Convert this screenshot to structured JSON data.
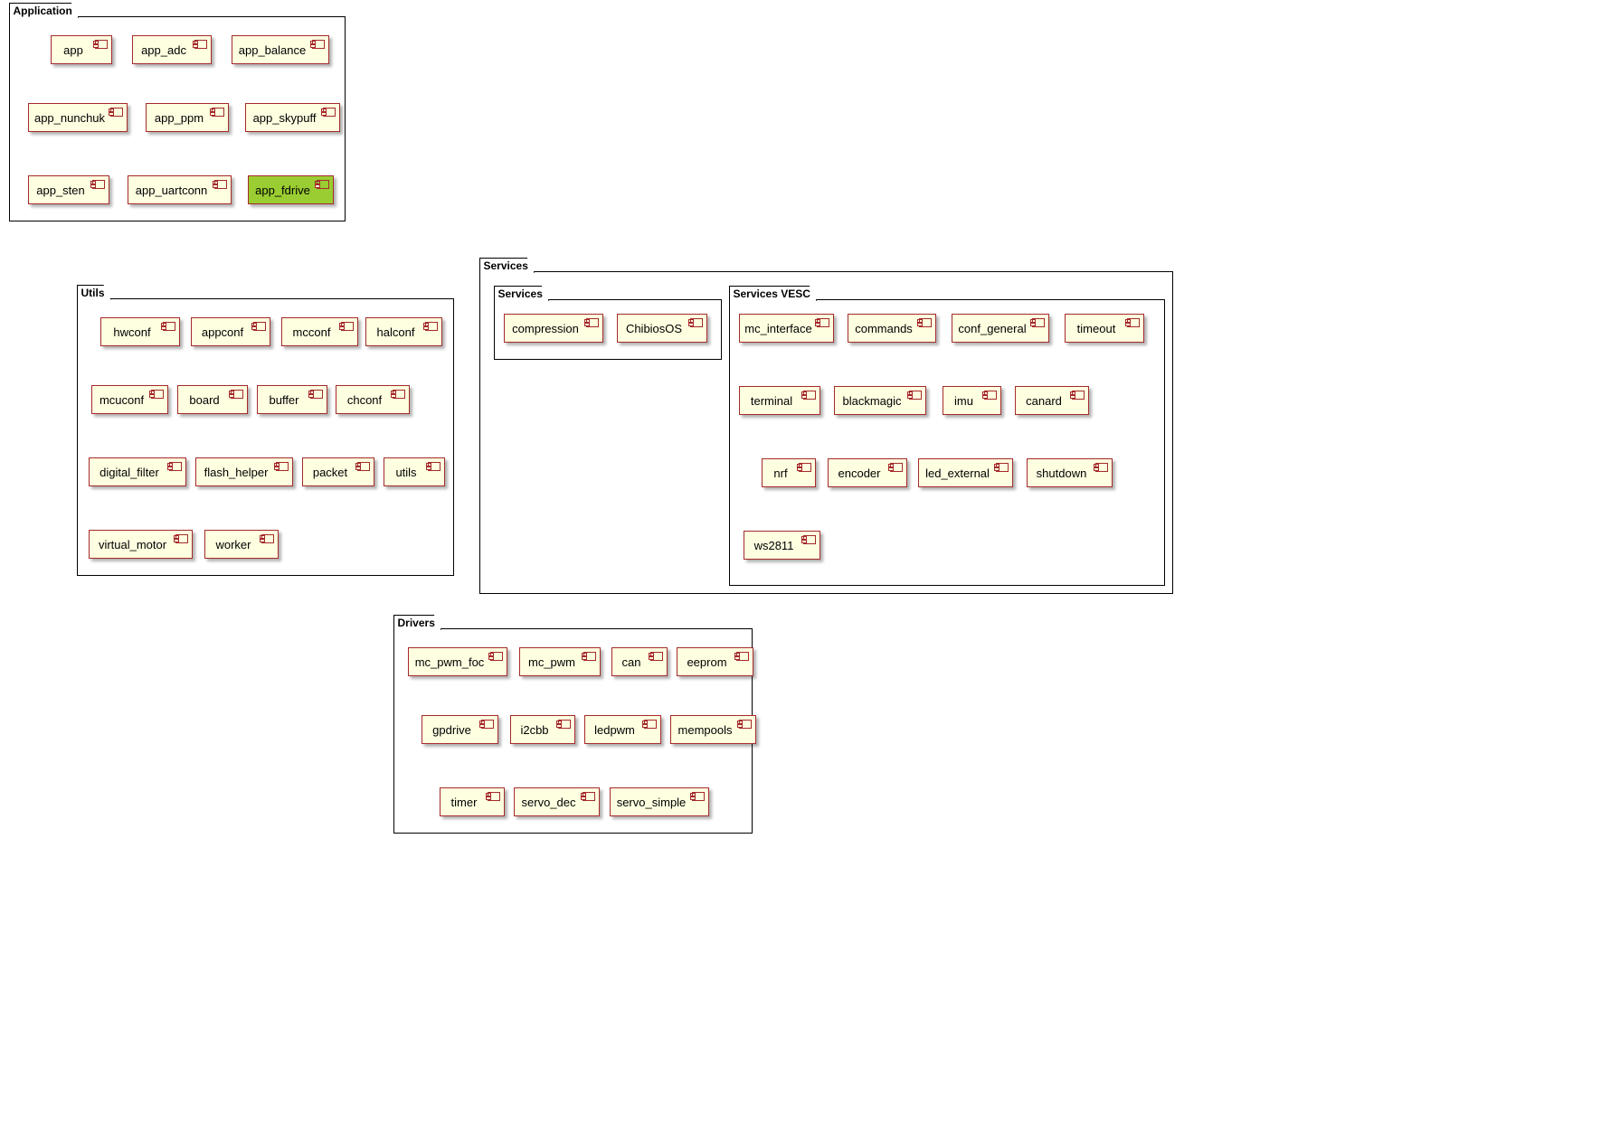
{
  "packages": {
    "application": {
      "title": "Application",
      "components": [
        "app",
        "app_adc",
        "app_balance",
        "app_nunchuk",
        "app_ppm",
        "app_skypuff",
        "app_sten",
        "app_uartconn",
        "app_fdrive"
      ]
    },
    "utils": {
      "title": "Utils",
      "components": [
        "hwconf",
        "appconf",
        "mcconf",
        "halconf",
        "mcuconf",
        "board",
        "buffer",
        "chconf",
        "digital_filter",
        "flash_helper",
        "packet",
        "utils",
        "virtual_motor",
        "worker"
      ]
    },
    "services": {
      "title": "Services",
      "inner": {
        "services_inner": {
          "title": "Services",
          "components": [
            "compression",
            "ChibiosOS"
          ]
        },
        "services_vesc": {
          "title": "Services VESC",
          "components": [
            "mc_interface",
            "commands",
            "conf_general",
            "timeout",
            "terminal",
            "blackmagic",
            "imu",
            "canard",
            "nrf",
            "encoder",
            "led_external",
            "shutdown",
            "ws2811"
          ]
        }
      }
    },
    "drivers": {
      "title": "Drivers",
      "components": [
        "mc_pwm_foc",
        "mc_pwm",
        "can",
        "eeprom",
        "gpdrive",
        "i2cbb",
        "ledpwm",
        "mempools",
        "timer",
        "servo_dec",
        "servo_simple"
      ]
    }
  }
}
